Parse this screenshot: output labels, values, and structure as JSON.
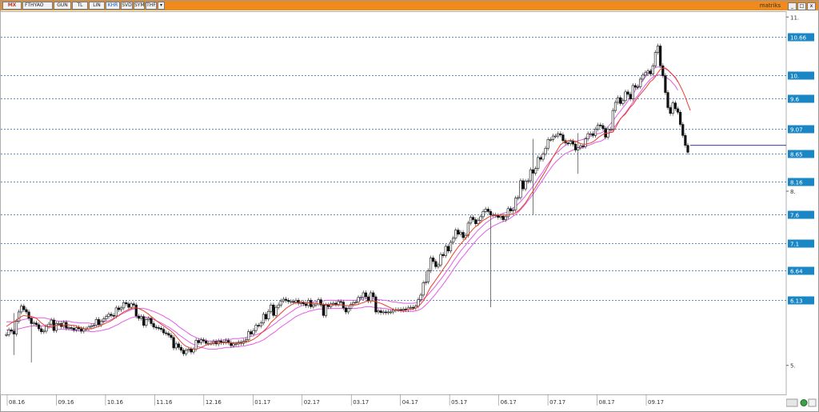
{
  "toolbar": {
    "logo": "MX",
    "symbol": "FTHYAO",
    "buttons": [
      "GUN",
      "TL",
      "LIN",
      "KHR",
      "SVD",
      "SYM",
      "THF"
    ],
    "active_button": "KHR",
    "dropdown_glyph": "▾",
    "brand": "matriks",
    "window_controls": [
      "_",
      "□",
      "x"
    ]
  },
  "colors": {
    "toolbar": "#f08a1c",
    "grid": "#3b62b8",
    "label_bg": "#1a86c4",
    "label_text": "#ffffff",
    "candle": "#111111",
    "ma_short": "#e8402a",
    "ma_band": "#e25ce6",
    "last_line": "#3a3aa8"
  },
  "chart_data": {
    "type": "candlestick",
    "x_tick_labels": [
      "08.16",
      "09.16",
      "10.16",
      "11.16",
      "12.16",
      "01.17",
      "02.17",
      "03.17",
      "04.17",
      "05.17",
      "06.17",
      "07.17",
      "08.17",
      "09.17"
    ],
    "y_ticks": [
      10.66,
      10.0,
      9.6,
      9.07,
      8.65,
      8.16,
      7.6,
      7.1,
      6.64,
      6.13
    ],
    "y_tick_labels": [
      "10.66",
      "10.",
      "9.6",
      "9.07",
      "8.65",
      "8.16",
      "7.6",
      "7.1",
      "6.64",
      "6.13"
    ],
    "y_plain_labels": [
      11,
      8,
      5
    ],
    "y_plain_label_texts": [
      "11.",
      "8.",
      "5."
    ],
    "ylim": [
      4.5,
      11.1
    ],
    "closes": [
      5.53,
      5.61,
      5.59,
      5.54,
      5.76,
      5.92,
      6.02,
      5.96,
      5.92,
      5.81,
      5.72,
      5.73,
      5.7,
      5.63,
      5.58,
      5.59,
      5.67,
      5.71,
      5.78,
      5.6,
      5.72,
      5.72,
      5.67,
      5.74,
      5.64,
      5.65,
      5.64,
      5.61,
      5.65,
      5.63,
      5.59,
      5.63,
      5.63,
      5.66,
      5.68,
      5.69,
      5.79,
      5.7,
      5.76,
      5.8,
      5.84,
      5.88,
      5.86,
      5.85,
      5.99,
      5.96,
      5.99,
      6.08,
      6.06,
      6.0,
      6.06,
      6.04,
      5.85,
      5.81,
      5.84,
      5.69,
      5.79,
      5.81,
      5.72,
      5.66,
      5.65,
      5.64,
      5.62,
      5.56,
      5.55,
      5.52,
      5.48,
      5.3,
      5.37,
      5.31,
      5.26,
      5.2,
      5.26,
      5.28,
      5.23,
      5.28,
      5.43,
      5.39,
      5.44,
      5.42,
      5.38,
      5.38,
      5.38,
      5.41,
      5.37,
      5.42,
      5.39,
      5.4,
      5.43,
      5.39,
      5.34,
      5.37,
      5.37,
      5.4,
      5.38,
      5.42,
      5.44,
      5.58,
      5.54,
      5.6,
      5.69,
      5.68,
      5.73,
      5.88,
      5.8,
      5.93,
      6.04,
      5.86,
      6.0,
      6.04,
      6.11,
      6.14,
      6.12,
      6.1,
      6.1,
      6.09,
      6.12,
      6.07,
      6.08,
      6.06,
      6.03,
      6.12,
      6.01,
      6.04,
      6.06,
      6.13,
      6.04,
      5.86,
      6.04,
      6.01,
      6.06,
      6.07,
      6.05,
      6.1,
      6.09,
      5.99,
      5.92,
      5.98,
      6.05,
      6.08,
      6.09,
      6.17,
      6.17,
      6.25,
      6.18,
      6.11,
      6.25,
      6.18,
      5.92,
      5.94,
      5.91,
      5.92,
      5.91,
      5.92,
      5.92,
      5.95,
      5.96,
      5.96,
      5.95,
      5.97,
      5.96,
      5.99,
      6.0,
      5.99,
      6.02,
      6.13,
      6.21,
      6.42,
      6.44,
      6.63,
      6.85,
      6.79,
      6.7,
      6.73,
      6.91,
      6.89,
      7.05,
      6.97,
      7.12,
      7.19,
      7.33,
      7.26,
      7.29,
      7.2,
      7.24,
      7.45,
      7.55,
      7.51,
      7.44,
      7.5,
      7.56,
      7.65,
      7.69,
      7.65,
      7.59,
      7.59,
      7.58,
      7.55,
      7.57,
      7.51,
      7.56,
      7.7,
      7.66,
      7.68,
      7.88,
      7.89,
      8.18,
      8.04,
      8.17,
      8.18,
      8.37,
      8.31,
      8.39,
      8.58,
      8.55,
      8.64,
      8.74,
      8.89,
      8.89,
      8.95,
      8.95,
      8.99,
      8.97,
      8.87,
      8.83,
      8.82,
      8.86,
      8.81,
      8.71,
      8.75,
      8.78,
      8.77,
      8.9,
      8.99,
      8.99,
      8.96,
      9.07,
      9.14,
      9.13,
      9.08,
      8.93,
      9.07,
      9.07,
      9.39,
      9.53,
      9.61,
      9.51,
      9.56,
      9.71,
      9.67,
      9.59,
      9.82,
      9.79,
      9.8,
      9.93,
      10.0,
      10.04,
      10.07,
      10.02,
      10.16,
      10.39,
      10.5,
      10.16,
      9.99,
      9.7,
      9.44,
      9.34,
      9.52,
      9.42,
      9.36,
      9.15,
      8.96,
      8.79,
      8.67
    ],
    "ma_short": [
      5.67,
      5.7,
      5.73,
      5.75,
      5.78,
      5.81,
      5.84,
      5.86,
      5.85,
      5.85,
      5.84,
      5.83,
      5.81,
      5.77,
      5.73,
      5.7,
      5.68,
      5.67,
      5.67,
      5.68,
      5.69,
      5.69,
      5.7,
      5.69,
      5.7,
      5.7,
      5.69,
      5.69,
      5.68,
      5.66,
      5.65,
      5.64,
      5.62,
      5.63,
      5.63,
      5.64,
      5.66,
      5.67,
      5.69,
      5.71,
      5.73,
      5.75,
      5.77,
      5.8,
      5.83,
      5.86,
      5.89,
      5.92,
      5.94,
      5.96,
      5.98,
      5.99,
      5.99,
      5.98,
      5.96,
      5.94,
      5.91,
      5.88,
      5.84,
      5.81,
      5.77,
      5.74,
      5.71,
      5.68,
      5.65,
      5.62,
      5.59,
      5.55,
      5.5,
      5.45,
      5.4,
      5.36,
      5.33,
      5.31,
      5.29,
      5.28,
      5.28,
      5.29,
      5.31,
      5.33,
      5.35,
      5.36,
      5.38,
      5.39,
      5.39,
      5.4,
      5.39,
      5.39,
      5.39,
      5.39,
      5.39,
      5.39,
      5.39,
      5.39,
      5.39,
      5.4,
      5.4,
      5.41,
      5.43,
      5.45,
      5.48,
      5.51,
      5.55,
      5.59,
      5.63,
      5.68,
      5.74,
      5.78,
      5.82,
      5.86,
      5.9,
      5.94,
      5.98,
      6.01,
      6.04,
      6.06,
      6.08,
      6.08,
      6.09,
      6.09,
      6.08,
      6.08,
      6.07,
      6.07,
      6.06,
      6.06,
      6.06,
      6.05,
      6.05,
      6.05,
      6.04,
      6.04,
      6.04,
      6.04,
      6.04,
      6.04,
      6.03,
      6.03,
      6.03,
      6.04,
      6.04,
      6.05,
      6.07,
      6.08,
      6.1,
      6.11,
      6.11,
      6.11,
      6.1,
      6.08,
      6.07,
      6.05,
      6.03,
      6.01,
      5.99,
      5.96,
      5.95,
      5.95,
      5.94,
      5.94,
      5.95,
      5.96,
      5.96,
      5.97,
      5.99,
      6.01,
      6.06,
      6.11,
      6.18,
      6.27,
      6.35,
      6.41,
      6.47,
      6.53,
      6.59,
      6.66,
      6.72,
      6.78,
      6.85,
      6.92,
      6.98,
      7.04,
      7.09,
      7.14,
      7.19,
      7.25,
      7.3,
      7.35,
      7.39,
      7.42,
      7.46,
      7.5,
      7.52,
      7.55,
      7.57,
      7.58,
      7.58,
      7.59,
      7.59,
      7.59,
      7.59,
      7.59,
      7.6,
      7.61,
      7.63,
      7.66,
      7.7,
      7.75,
      7.8,
      7.87,
      7.94,
      8.0,
      8.07,
      8.14,
      8.21,
      8.28,
      8.35,
      8.43,
      8.51,
      8.59,
      8.66,
      8.73,
      8.8,
      8.83,
      8.85,
      8.87,
      8.88,
      8.87,
      8.86,
      8.84,
      8.82,
      8.81,
      8.81,
      8.82,
      8.83,
      8.85,
      8.88,
      8.92,
      8.95,
      8.98,
      9.0,
      9.0,
      9.01,
      9.02,
      9.09,
      9.17,
      9.25,
      9.29,
      9.33,
      9.39,
      9.45,
      9.49,
      9.56,
      9.62,
      9.67,
      9.72,
      9.77,
      9.83,
      9.89,
      9.92,
      9.97,
      10.04,
      10.1,
      10.12,
      10.12,
      10.09,
      10.04,
      10.0,
      9.96,
      9.89,
      9.81,
      9.72,
      9.62,
      9.5,
      9.39
    ],
    "ma_band_center": [
      5.68,
      5.68,
      5.68,
      5.68,
      5.69,
      5.7,
      5.71,
      5.72,
      5.73,
      5.74,
      5.75,
      5.75,
      5.75,
      5.75,
      5.75,
      5.75,
      5.74,
      5.73,
      5.72,
      5.71,
      5.7,
      5.69,
      5.69,
      5.69,
      5.69,
      5.69,
      5.68,
      5.67,
      5.67,
      5.66,
      5.66,
      5.66,
      5.66,
      5.66,
      5.65,
      5.65,
      5.66,
      5.66,
      5.67,
      5.68,
      5.69,
      5.7,
      5.72,
      5.74,
      5.76,
      5.78,
      5.81,
      5.83,
      5.85,
      5.87,
      5.89,
      5.9,
      5.91,
      5.91,
      5.91,
      5.91,
      5.9,
      5.89,
      5.87,
      5.86,
      5.84,
      5.82,
      5.8,
      5.78,
      5.75,
      5.73,
      5.7,
      5.67,
      5.64,
      5.6,
      5.57,
      5.54,
      5.51,
      5.48,
      5.45,
      5.43,
      5.41,
      5.39,
      5.38,
      5.37,
      5.36,
      5.35,
      5.35,
      5.35,
      5.35,
      5.36,
      5.36,
      5.37,
      5.38,
      5.38,
      5.38,
      5.39,
      5.39,
      5.39,
      5.4,
      5.4,
      5.41,
      5.42,
      5.43,
      5.44,
      5.46,
      5.47,
      5.49,
      5.51,
      5.54,
      5.57,
      5.6,
      5.63,
      5.66,
      5.7,
      5.73,
      5.76,
      5.79,
      5.82,
      5.85,
      5.88,
      5.91,
      5.93,
      5.95,
      5.97,
      5.98,
      6.0,
      6.01,
      6.02,
      6.03,
      6.04,
      6.04,
      6.04,
      6.05,
      6.05,
      6.05,
      6.05,
      6.05,
      6.05,
      6.05,
      6.05,
      6.05,
      6.05,
      6.05,
      6.05,
      6.05,
      6.06,
      6.06,
      6.07,
      6.08,
      6.08,
      6.08,
      6.07,
      6.07,
      6.06,
      6.06,
      6.05,
      6.05,
      6.04,
      6.03,
      6.02,
      6.02,
      6.01,
      6.01,
      6.0,
      6.0,
      6.0,
      6.0,
      6.0,
      6.01,
      6.02,
      6.04,
      6.07,
      6.11,
      6.15,
      6.2,
      6.25,
      6.3,
      6.36,
      6.41,
      6.47,
      6.53,
      6.59,
      6.65,
      6.72,
      6.78,
      6.84,
      6.9,
      6.95,
      7.0,
      7.06,
      7.11,
      7.16,
      7.21,
      7.26,
      7.3,
      7.34,
      7.38,
      7.41,
      7.44,
      7.47,
      7.49,
      7.51,
      7.53,
      7.55,
      7.56,
      7.58,
      7.61,
      7.64,
      7.67,
      7.71,
      7.75,
      7.8,
      7.85,
      7.91,
      7.96,
      8.02,
      8.08,
      8.15,
      8.21,
      8.27,
      8.34,
      8.4,
      8.46,
      8.52,
      8.57,
      8.61,
      8.65,
      8.69,
      8.72,
      8.74,
      8.76,
      8.78,
      8.79,
      8.8,
      8.81,
      8.82,
      8.84,
      8.86,
      8.87,
      8.89,
      8.91,
      8.92,
      8.93,
      8.95,
      8.99,
      9.04,
      9.09,
      9.14,
      9.2,
      9.26,
      9.31,
      9.37,
      9.42,
      9.48,
      9.54,
      9.6,
      9.67,
      9.72,
      9.78,
      9.84,
      9.9,
      9.95,
      10.0,
      10.03,
      10.06,
      10.07,
      10.07,
      10.06,
      10.04,
      10.01,
      9.98,
      9.93,
      9.88,
      9.81
    ],
    "ma_band_halfwidth": 0.07,
    "last_value": 8.79
  }
}
